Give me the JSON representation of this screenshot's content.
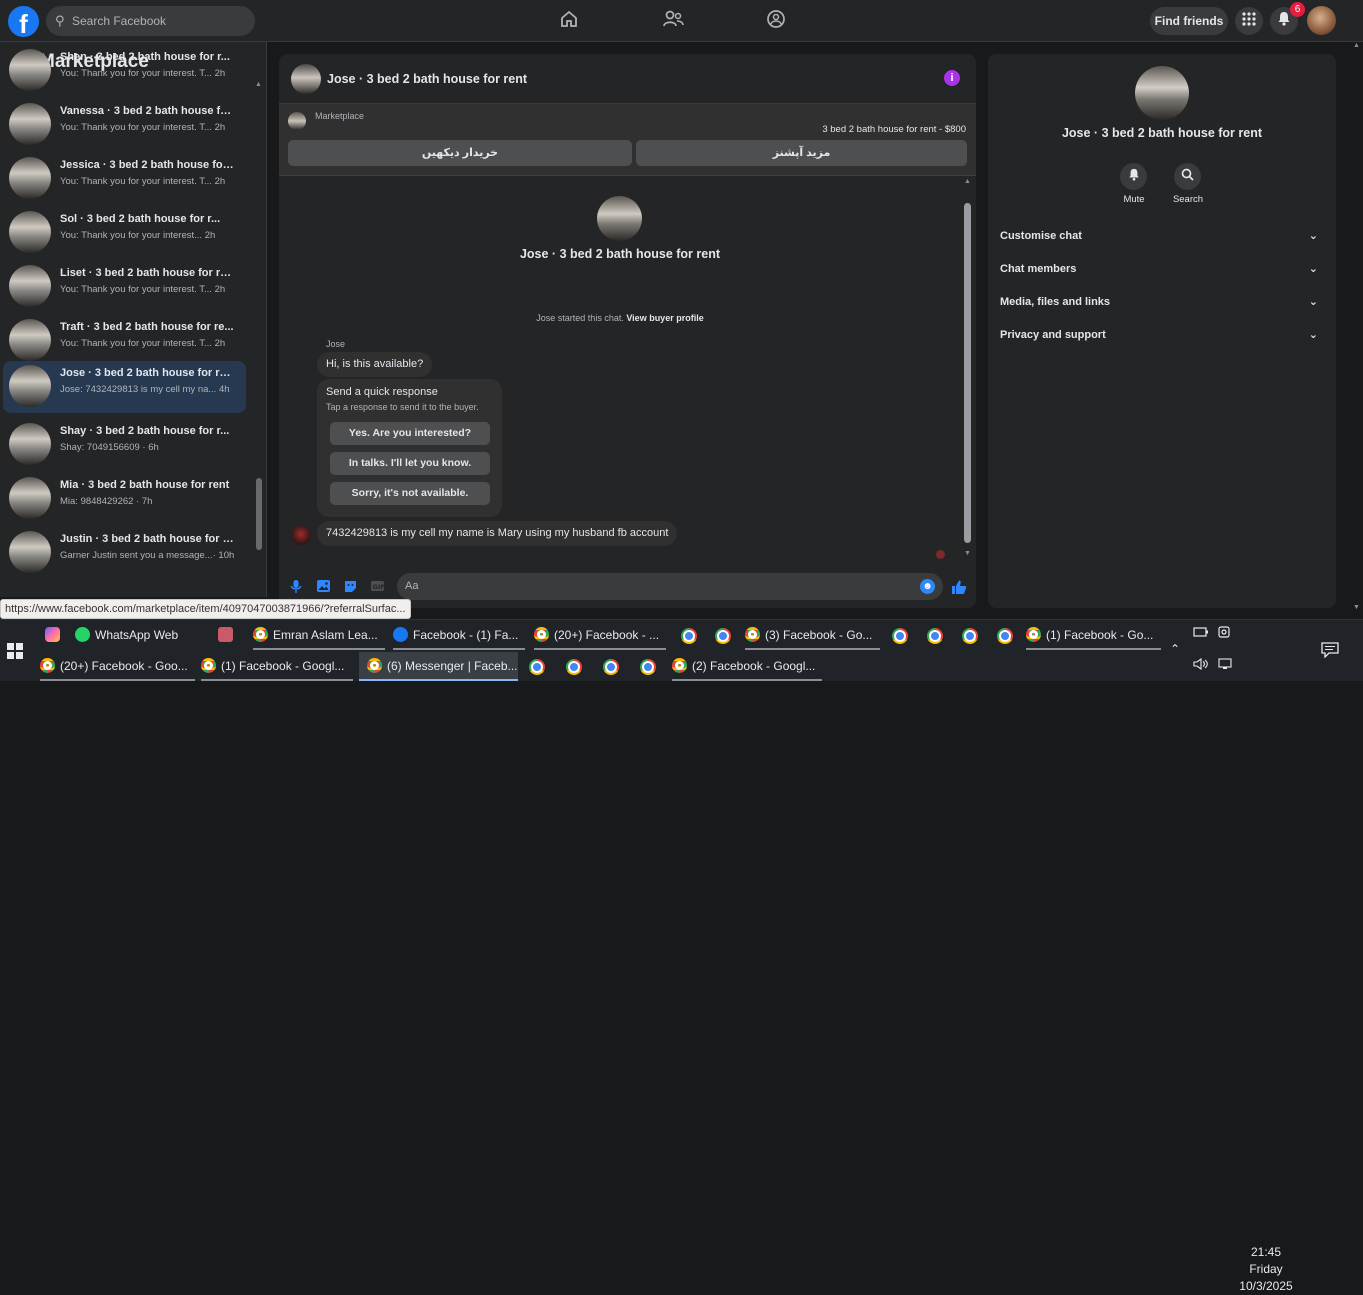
{
  "topbar": {
    "logo": "f",
    "search_placeholder": "Search Facebook",
    "find_friends": "Find friends",
    "notif_count": "6"
  },
  "sidebar": {
    "title": "Marketplace",
    "conversations": [
      {
        "name": "Shen · 3 bed 2 bath house for r...",
        "preview": "You: Thank you for your interest. T...",
        "time": "2h"
      },
      {
        "name": "Vanessa · 3 bed 2 bath house fo...",
        "preview": "You: Thank you for your interest. T...",
        "time": "2h"
      },
      {
        "name": "Jessica · 3 bed 2 bath house for...",
        "preview": "You: Thank you for your interest. T...",
        "time": "2h"
      },
      {
        "name": "Sol · 3 bed 2 bath house for r...",
        "preview": "You: Thank you for your interest...",
        "time": "2h"
      },
      {
        "name": "Liset · 3 bed 2 bath house for re...",
        "preview": "You: Thank you for your interest. T...",
        "time": "2h"
      },
      {
        "name": "Traft · 3 bed 2 bath house for re...",
        "preview": "You: Thank you for your interest. T...",
        "time": "2h"
      },
      {
        "name": "Jose · 3 bed 2 bath house for rent",
        "preview": "Jose: 7432429813 is my cell my na...",
        "time": "4h"
      },
      {
        "name": "Shay · 3 bed 2 bath house for r...",
        "preview": "Shay: 7049156609 ·",
        "time": "6h"
      },
      {
        "name": "Mia · 3 bed 2 bath house for rent",
        "preview": "Mia: 9848429262 ·",
        "time": "7h"
      },
      {
        "name": "Justin · 3 bed 2 bath house for r...",
        "preview": "Garner Justin sent you a message...·",
        "time": "10h"
      }
    ]
  },
  "chat": {
    "title": "Jose · 3 bed 2 bath house for rent",
    "marketplace_label": "Marketplace",
    "listing_price": "3 bed 2 bath house for rent - $800",
    "btn_view_buyer": "خریدار دیکھیں",
    "btn_more_options": "مزید آپشنز",
    "started_text": "Jose started this chat.",
    "view_buyer_profile": "View buyer profile",
    "sender_name": "Jose",
    "msg_available": "Hi, is this available?",
    "quick_title": "Send a quick response",
    "quick_sub": "Tap a response to send it to the buyer.",
    "quick_options": [
      "Yes. Are you interested?",
      "In talks. I'll let you know.",
      "Sorry, it's not available."
    ],
    "msg_phone": "7432429813 is my cell my name is Mary using my husband fb account",
    "composer_placeholder": "Aa"
  },
  "right_panel": {
    "title": "Jose · 3 bed 2 bath house for rent",
    "mute_label": "Mute",
    "search_label": "Search",
    "sections": [
      "Customise chat",
      "Chat members",
      "Media, files and links",
      "Privacy and support"
    ]
  },
  "url_tooltip": "https://www.facebook.com/marketplace/item/4097047003871966/?referralSurfac...",
  "taskbar": {
    "row1": [
      "WhatsApp Web",
      "Emran Aslam Lea...",
      "Facebook - (1) Fa...",
      "(20+) Facebook - ...",
      "(3) Facebook - Go...",
      "(1) Facebook - Go..."
    ],
    "row2": [
      "(20+) Facebook - Goo...",
      "(1) Facebook - Googl...",
      "(6) Messenger | Faceb...",
      "(2) Facebook - Googl..."
    ],
    "time": "21:45",
    "day": "Friday",
    "date": "10/3/2025"
  },
  "colors": {
    "brand": "#1877f2",
    "messenger_accent": "#a933e6",
    "badge": "#e41e3f"
  }
}
